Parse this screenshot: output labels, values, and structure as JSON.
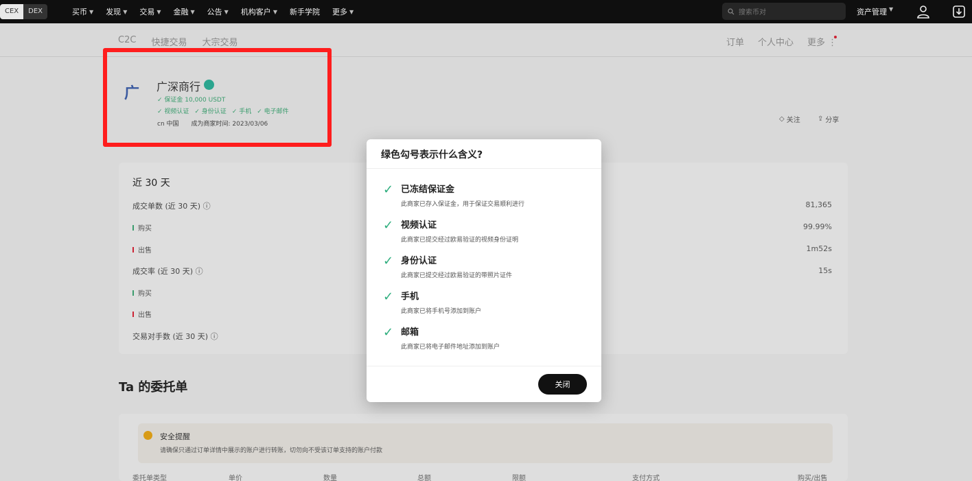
{
  "topbar": {
    "switch": [
      "CEX",
      "DEX"
    ],
    "nav": [
      "买币",
      "发现",
      "交易",
      "金融",
      "公告",
      "机构客户",
      "新手学院",
      "更多"
    ],
    "nav_has_chevron": [
      true,
      true,
      true,
      true,
      true,
      true,
      false,
      true
    ],
    "search_placeholder": "搜索币对",
    "asset_label": "资产管理"
  },
  "subnav": [
    "C2C",
    "快捷交易",
    "大宗交易"
  ],
  "rightnav": [
    "订单",
    "个人中心",
    "更多"
  ],
  "merchant": {
    "name": "广深商行",
    "logo_char": "广",
    "deposit": "✓ 保证金 10,000 USDT",
    "badges": [
      "✓ 视频认证",
      "✓ 身份认证",
      "✓ 手机",
      "✓ 电子邮件"
    ],
    "region": "cn 中国",
    "since": "成为商家时间: 2023/03/06"
  },
  "actions": {
    "follow": "关注",
    "share": "分享"
  },
  "stats": {
    "title": "近 30 天",
    "rows": [
      {
        "label": "成交单数 (近 30 天) ⓘ",
        "value": "81,365"
      },
      {
        "label": "购买",
        "value": "99.99%",
        "bar": "#3a9c6d"
      },
      {
        "label": "出售",
        "value": "1m52s",
        "bar": "#c23"
      },
      {
        "label": "成交率 (近 30 天) ⓘ",
        "value": "15s"
      },
      {
        "label": "购买",
        "value": "",
        "bar": "#3a9c6d"
      },
      {
        "label": "出售",
        "value": "",
        "bar": "#c23"
      },
      {
        "label": "交易对手数 (近 30 天) ⓘ",
        "value": ""
      }
    ]
  },
  "orders": {
    "title": "Ta 的委托单",
    "notice_title": "安全提醒",
    "notice_text": "请确保只通过订单详情中展示的账户进行转账，切勿向不受该订单支持的账户付款",
    "columns": [
      "委托单类型",
      "单价",
      "数量",
      "总额",
      "限额",
      "支付方式",
      "购买/出售"
    ]
  },
  "modal": {
    "title": "绿色勾号表示什么含义?",
    "items": [
      {
        "title": "已冻结保证金",
        "desc": "此商家已存入保证金，用于保证交易顺利进行"
      },
      {
        "title": "视频认证",
        "desc": "此商家已提交经过欧易验证的视频身份证明"
      },
      {
        "title": "身份认证",
        "desc": "此商家已提交经过欧易验证的带照片证件"
      },
      {
        "title": "手机",
        "desc": "此商家已将手机号添加到账户"
      },
      {
        "title": "邮箱",
        "desc": "此商家已将电子邮件地址添加到账户"
      }
    ],
    "close_label": "关闭"
  },
  "colors": {
    "check_green": "#2fae7e",
    "highlight_red": "#ff1d1d",
    "topbar_bg": "#0f0f0f"
  }
}
